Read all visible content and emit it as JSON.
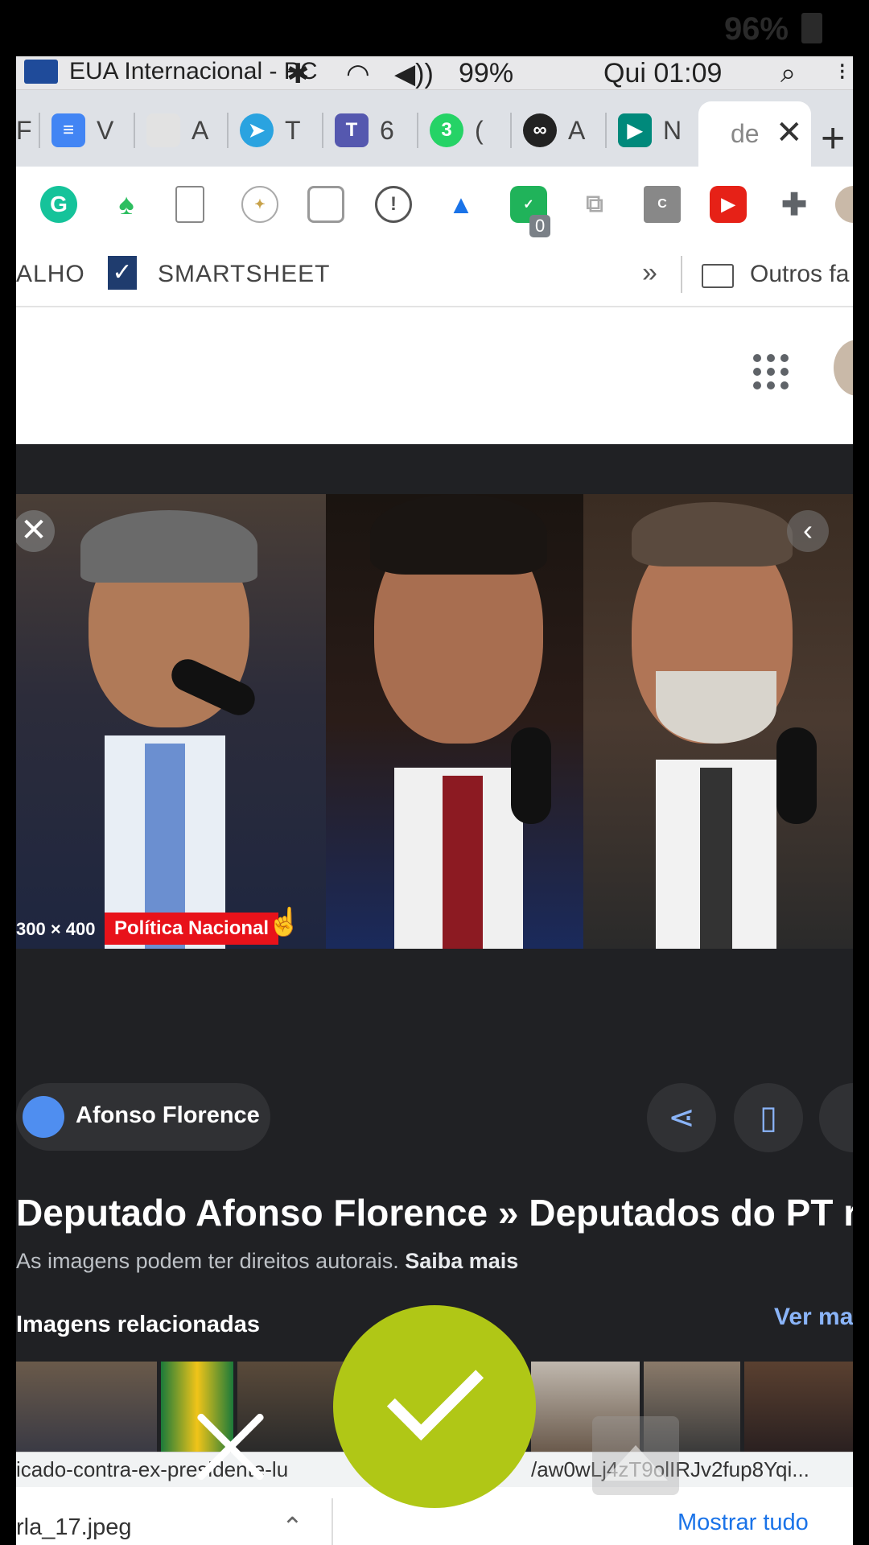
{
  "phone_status": {
    "battery": "96%"
  },
  "menubar": {
    "input_source": "EUA Internacional - PC",
    "volume": "99%",
    "clock": "Qui 01:09"
  },
  "tabs": [
    {
      "label": "V",
      "color": "#4285f4",
      "icon": "docs-icon"
    },
    {
      "label": "A",
      "color": "#bdbdbd",
      "icon": "file-icon"
    },
    {
      "label": "T",
      "color": "#2aa3e0",
      "icon": "telegram-icon"
    },
    {
      "label": "6",
      "color": "#5558af",
      "icon": "teams-icon"
    },
    {
      "label": "(",
      "color": "#25d366",
      "icon": "whatsapp-icon",
      "badge": "3"
    },
    {
      "label": "A",
      "color": "#222222",
      "icon": "infinity-icon"
    },
    {
      "label": "N",
      "color": "#00897b",
      "icon": "meet-icon"
    }
  ],
  "active_tab": {
    "label": "de"
  },
  "extensions": {
    "badge": "0"
  },
  "bookmarks": {
    "partial_left": "ALHO",
    "smartsheet_icon": "✓",
    "smartsheet": "SMARTSHEET",
    "overflow": "»",
    "others": "Outros fa"
  },
  "preview": {
    "dimensions": "300 × 400",
    "source_badge": "Política Nacional",
    "close_glyph": "✕",
    "prev_glyph": "‹",
    "site_name": "Afonso Florence",
    "title": "Deputado Afonso Florence » Deputados do PT re",
    "copyright": "As imagens podem ter direitos autorais.",
    "learn_more": "Saiba mais",
    "related": "Imagens relacionadas",
    "see_more": "Ver ma"
  },
  "status": {
    "url_left": "icado-contra-ex-presidente-lu",
    "url_right": "/aw0wLj4zT9olIRJv2fup8Yqi..."
  },
  "downloads": {
    "file": "rla_17.jpeg",
    "show_all": "Mostrar tudo"
  },
  "colors": {
    "confirm": "#b0c716",
    "badge_red": "#e8121a",
    "link_blue": "#8ab4f8"
  }
}
